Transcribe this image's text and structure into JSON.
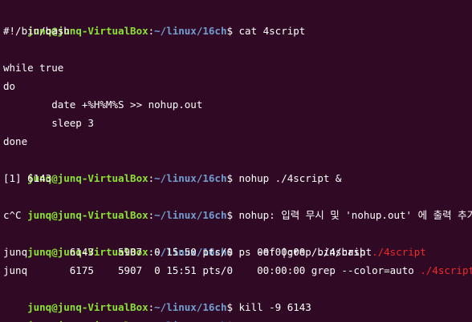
{
  "prompt": {
    "user_host": "junq@junq-VirtualBox",
    "sep": ":",
    "path": "~/linux/16ch",
    "dollar": "$"
  },
  "lines": [
    {
      "cmd": " cat 4script"
    },
    {
      "text": "#!/bin/bash"
    },
    {
      "text": ""
    },
    {
      "text": "while true"
    },
    {
      "text": "do"
    },
    {
      "text": "        date +%H%M%S >> nohup.out"
    },
    {
      "text": "        sleep 3"
    },
    {
      "text": "done"
    },
    {
      "cmd": " nohup ./4script &"
    },
    {
      "text": "[1] 6143"
    },
    {
      "cmd": " nohup: 입력 무시 및 'nohup.out' 에 출력 추가"
    },
    {
      "text": "c^C"
    },
    {
      "cmd": " ps -ef |grep ./4script"
    },
    {
      "text": "junq       6143    5907  0 15:50 pts/0    00:00:00 /bin/bash ",
      "match": "./4script"
    },
    {
      "text": "junq       6175    5907  0 15:51 pts/0    00:00:00 grep --color=auto ",
      "match": "./4script"
    },
    {
      "cmd": " kill -9 6143"
    },
    {
      "cmd": ""
    }
  ]
}
